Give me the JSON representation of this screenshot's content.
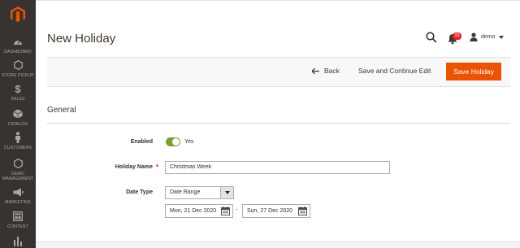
{
  "sidebar": {
    "logo_icon": "magento-logo",
    "accent": "#eb5202",
    "items": [
      {
        "label": "DASHBOARD",
        "icon": "speedometer-icon"
      },
      {
        "label": "STORE PICKUP",
        "icon": "hexagon-icon"
      },
      {
        "label": "SALES",
        "icon": "dollar-icon"
      },
      {
        "label": "CATALOG",
        "icon": "cube-icon"
      },
      {
        "label": "CUSTOMERS",
        "icon": "person-icon"
      },
      {
        "label": "DEMO MANAGEMENT",
        "icon": "hexagon-icon"
      },
      {
        "label": "MARKETING",
        "icon": "megaphone-icon"
      },
      {
        "label": "CONTENT",
        "icon": "layout-icon"
      },
      {
        "label": "",
        "icon": "bar-chart-icon"
      }
    ]
  },
  "header": {
    "title": "New Holiday",
    "notifications_count": "33",
    "user_name": "demo"
  },
  "actions": {
    "back_label": "Back",
    "save_continue_label": "Save and Continue Edit",
    "save_label": "Save Holiday",
    "save_color": "#eb5202"
  },
  "form": {
    "section_title": "General",
    "enabled_label": "Enabled",
    "enabled_value": "Yes",
    "toggle_color": "#79a22e",
    "holiday_name_label": "Holiday Name",
    "holiday_name_value": "Christmas Week",
    "date_type_label": "Date Type",
    "date_type_value": "Date Range",
    "date_from": "Mon, 21 Dec 2020",
    "date_to": "Sun, 27 Dec 2020",
    "range_separator": "-"
  }
}
